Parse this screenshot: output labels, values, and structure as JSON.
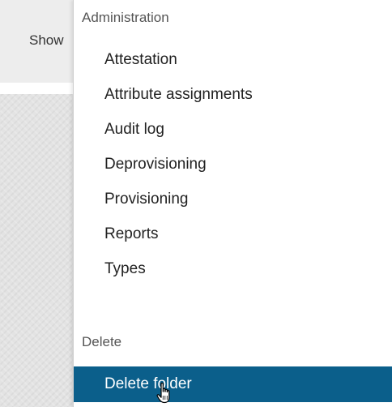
{
  "toolbar": {
    "show_label": "Show"
  },
  "menu": {
    "sections": [
      {
        "header": "Administration",
        "items": [
          {
            "label": "Attestation"
          },
          {
            "label": "Attribute assignments"
          },
          {
            "label": "Audit log"
          },
          {
            "label": "Deprovisioning"
          },
          {
            "label": "Provisioning"
          },
          {
            "label": "Reports"
          },
          {
            "label": "Types"
          }
        ]
      },
      {
        "header": "Delete",
        "items": [
          {
            "label": "Delete folder",
            "state": "hover"
          }
        ]
      }
    ]
  },
  "colors": {
    "highlight": "#0b5f8b",
    "header_text": "#555555",
    "item_text": "#222222"
  }
}
